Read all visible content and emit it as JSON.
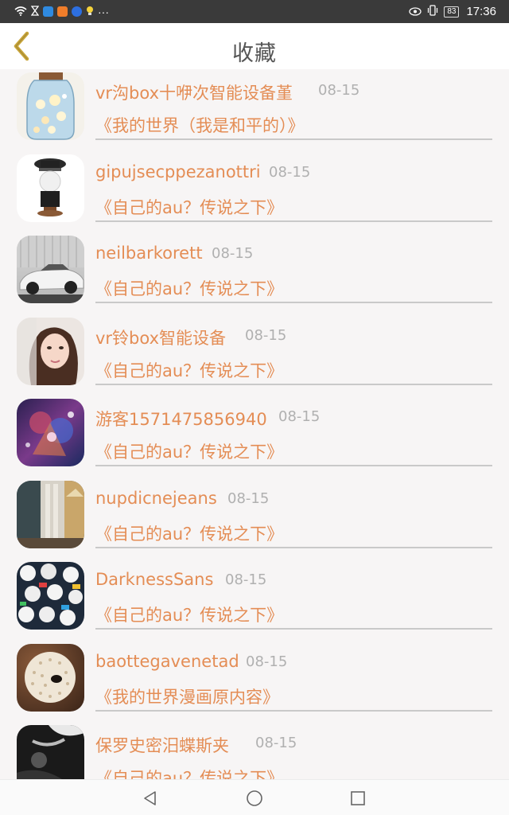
{
  "status_bar": {
    "time": "17:36",
    "battery": "83",
    "icons": [
      "wifi-icon",
      "hourglass-icon",
      "app-icon-blue",
      "app-icon-play",
      "app-icon-k",
      "bulb-icon",
      "more-dots"
    ],
    "more": "···"
  },
  "header": {
    "title": "收藏",
    "back_icon": "back-chevron-icon"
  },
  "favorites": [
    {
      "user": "vr沟box十咿次智能设备堇",
      "date": "08-15",
      "title": "《我的世界（我是和平的）》",
      "avatar": "jar-avatar"
    },
    {
      "user": "gipujsecppezanottri",
      "date": "08-15",
      "title": "《自己的au？传说之下》",
      "avatar": "police-avatar"
    },
    {
      "user": "neilbarkorett",
      "date": "08-15",
      "title": "《自己的au？传说之下》",
      "avatar": "car-avatar"
    },
    {
      "user": "vr铃box智能设备",
      "date": "08-15",
      "title": "《自己的au？传说之下》",
      "avatar": "girl-avatar"
    },
    {
      "user": "游客1571475856940",
      "date": "08-15",
      "title": "《自己的au？传说之下》",
      "avatar": "anime-avatar"
    },
    {
      "user": "nupdicnejeans",
      "date": "08-15",
      "title": "《自己的au？传说之下》",
      "avatar": "room-avatar"
    },
    {
      "user": "DarknessSans",
      "date": "08-15",
      "title": "《自己的au？传说之下》",
      "avatar": "sans-avatar"
    },
    {
      "user": "baottegavenetad",
      "date": "08-15",
      "title": "《我的世界漫画原内容》",
      "avatar": "urchin-avatar"
    },
    {
      "user": "保罗史密汨蝶斯夹",
      "date": "08-15",
      "title": "《自己的au？传说之下》",
      "avatar": "dark-avatar"
    }
  ],
  "nav_bar": {
    "icons": [
      "back-triangle-icon",
      "home-circle-icon",
      "recents-square-icon"
    ]
  },
  "colors": {
    "accent": "#e48d55",
    "back_icon": "#c9a53a",
    "date": "#b0b0b0"
  }
}
